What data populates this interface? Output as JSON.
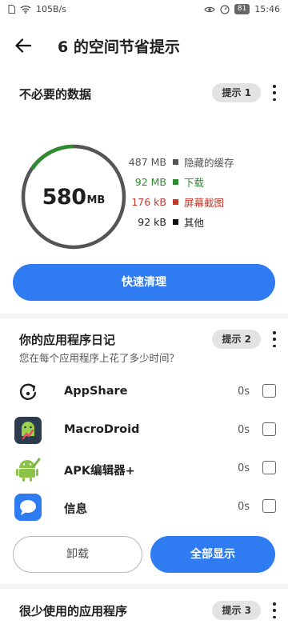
{
  "statusbar": {
    "speed": "105B/s",
    "battery": "81",
    "time": "15:46"
  },
  "header": {
    "title": "6 的空间节省提示"
  },
  "unneeded": {
    "title": "不必要的数据",
    "tip": "提示 1",
    "total_value": "580",
    "total_unit": "MB",
    "items": [
      {
        "value": "487 MB",
        "label": "隐藏的缓存",
        "color": "#555555",
        "text_color": "#555555"
      },
      {
        "value": "92 MB",
        "label": "下载",
        "color": "#2e8b2e",
        "text_color": "#2e8b2e"
      },
      {
        "value": "176 kB",
        "label": "屏幕截图",
        "color": "#c0392b",
        "text_color": "#c0392b"
      },
      {
        "value": "92 kB",
        "label": "其他",
        "color": "#111111",
        "text_color": "#222222"
      }
    ],
    "clean_button": "快速清理"
  },
  "diary": {
    "title": "你的应用程序日记",
    "tip": "提示 2",
    "subtitle": "您在每个应用程序上花了多少时间？",
    "apps": [
      {
        "name": "AppShare",
        "time": "0s",
        "icon": "appshare-icon"
      },
      {
        "name": "MacroDroid",
        "time": "0s",
        "icon": "macrodroid-icon"
      },
      {
        "name": "APK编辑器+",
        "time": "0s",
        "icon": "apk-editor-icon"
      },
      {
        "name": "信息",
        "time": "0s",
        "icon": "messages-icon"
      }
    ],
    "uninstall_button": "卸载",
    "show_all_button": "全部显示"
  },
  "rarely": {
    "title": "很少使用的应用程序",
    "tip": "提示 3"
  },
  "colors": {
    "accent": "#2f7bf2",
    "ring_gray": "#555555",
    "ring_green": "#2e8b2e"
  }
}
